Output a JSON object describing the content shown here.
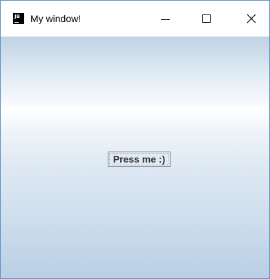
{
  "window": {
    "title": "My window!",
    "app_icon": "jb-icon",
    "controls": {
      "minimize": "minimize-icon",
      "maximize": "maximize-icon",
      "close": "close-icon"
    },
    "border_color": "#5b8fc7"
  },
  "content": {
    "button_label": "Press me :)"
  },
  "colors": {
    "gradient_top": "#c0d2e4",
    "gradient_highlight": "#ffffff",
    "gradient_bottom": "#b9cfe5"
  }
}
